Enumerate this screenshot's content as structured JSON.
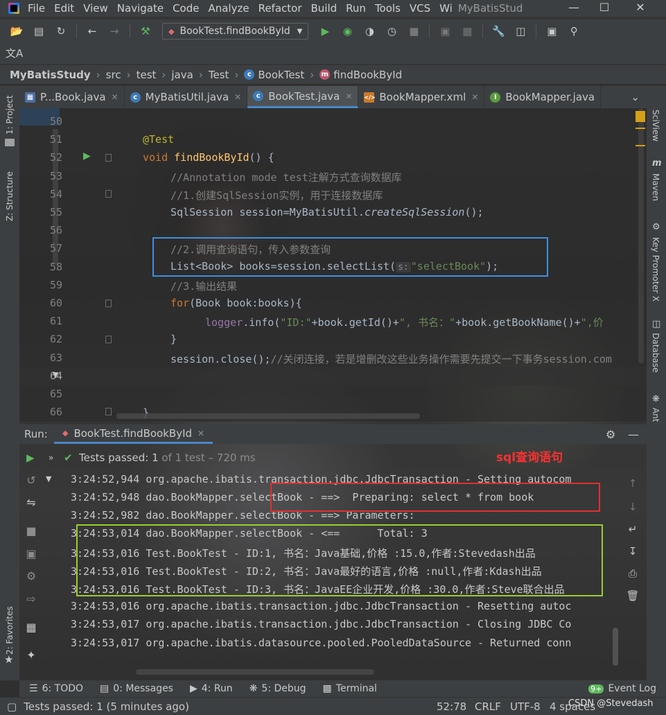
{
  "menu": [
    "File",
    "Edit",
    "View",
    "Navigate",
    "Code",
    "Analyze",
    "Refactor",
    "Build",
    "Run",
    "Tools",
    "VCS",
    "Wi"
  ],
  "window_title": "MyBatisStud",
  "toolbar": {
    "run_config": "BookTest.findBookById"
  },
  "translate_icon": "文A",
  "breadcrumbs": [
    "MyBatisStudy",
    "src",
    "test",
    "java",
    "Test",
    "BookTest",
    "findBookById"
  ],
  "tabs": [
    {
      "label": "P...Book.java",
      "icon_color": "#4a6fa5",
      "icon": "class-icon"
    },
    {
      "label": "MyBatisUtil.java",
      "icon_color": "#3d7ab8",
      "icon": "class-icon"
    },
    {
      "label": "BookTest.java",
      "icon_color": "#3d7ab8",
      "icon": "class-icon",
      "active": true
    },
    {
      "label": "BookMapper.xml",
      "icon_color": "#c87a2c",
      "icon": "xml-icon"
    },
    {
      "label": "BookMapper.java",
      "icon_color": "#5a9c3e",
      "icon": "interface-icon"
    }
  ],
  "left_tools": [
    "1: Project",
    "Z: Structure",
    "2: Favorites"
  ],
  "right_tools": [
    "SciView",
    "Maven",
    "Key Promoter X",
    "Database",
    "Ant"
  ],
  "editor": {
    "line_numbers": [
      "50",
      "51",
      "52",
      "53",
      "54",
      "55",
      "56",
      "57",
      "58",
      "59",
      "60",
      "61",
      "62",
      "63",
      "64",
      "65",
      "66"
    ],
    "lines": {
      "l51": "@Test",
      "l52_kw": "void",
      "l52_fn": "findBookById",
      "l52_rest": "() {",
      "l53": "//Annotation mode test注解方式查询数据库",
      "l54": "//1.创建SqlSession实例，用于连接数据库",
      "l55_a": "SqlSession session=MyBatisUtil.",
      "l55_b": "createSqlSession",
      "l55_c": "();",
      "l57": "//2.调用查询语句，传入参数查询",
      "l58_a": "List<Book> books=session.selectList(",
      "l58_hint": "s:",
      "l58_str": "\"selectBook\"",
      "l58_c": ");",
      "l59": "//3.输出结果",
      "l60_kw": "for",
      "l60_rest": "(Book book:books){",
      "l61_fld": "logger",
      "l61_a": ".info(",
      "l61_s1": "\"ID:\"",
      "l61_b": "+book.getId()+",
      "l61_s2": "\", 书名：\"",
      "l61_c": "+book.getBookName()+",
      "l61_s3": "\",价",
      "l62": "}",
      "l63_a": "session.close();",
      "l63_cm": "//关闭连接，若是增删改这些业务操作需要先提交一下事务session.com",
      "l66": "}"
    }
  },
  "run": {
    "label": "Run:",
    "tab": "BookTest.findBookById",
    "status_passed": "Tests passed:",
    "status_count": "1",
    "status_detail": "of 1 test – 720 ms",
    "annotation": "sql查询语句",
    "console": [
      "3:24:52,944 org.apache.ibatis.transaction.jdbc.JdbcTransaction - Setting autocom",
      "3:24:52,948 dao.BookMapper.selectBook - ==>  Preparing: select * from book",
      "3:24:52,982 dao.BookMapper.selectBook - ==> Parameters: ",
      "3:24:53,014 dao.BookMapper.selectBook - <==      Total: 3",
      "3:24:53,016 Test.BookTest - ID:1, 书名：Java基础,价格 :15.0,作者:Stevedash出品",
      "3:24:53,016 Test.BookTest - ID:2, 书名：Java最好的语言,价格 :null,作者:Kdash出品",
      "3:24:53,016 Test.BookTest - ID:3, 书名：JavaEE企业开发,价格 :30.0,作者:Steve联合出品",
      "3:24:53,016 org.apache.ibatis.transaction.jdbc.JdbcTransaction - Resetting autoc",
      "3:24:53,017 org.apache.ibatis.transaction.jdbc.JdbcTransaction - Closing JDBC Co",
      "3:24:53,017 org.apache.ibatis.datasource.pooled.PooledDataSource - Returned conn"
    ]
  },
  "tool_tabs": [
    {
      "label": "6: TODO",
      "icon": "list-icon"
    },
    {
      "label": "0: Messages",
      "icon": "messages-icon"
    },
    {
      "label": "4: Run",
      "icon": "run-icon"
    },
    {
      "label": "5: Debug",
      "icon": "debug-icon"
    },
    {
      "label": "Terminal",
      "icon": "terminal-icon"
    }
  ],
  "event_log": {
    "badge": "9+",
    "label": "Event Log"
  },
  "statusbar": {
    "message": "Tests passed: 1 (5 minutes ago)",
    "position": "52:78",
    "line_sep": "CRLF",
    "encoding": "UTF-8",
    "indent": "4 spaces",
    "watermark": "CSDN @Stevedash"
  },
  "colors": {
    "blue_box": "#3d8fe0",
    "red_box": "#e03030",
    "green_box": "#9acd32",
    "annotation": "#ff3030",
    "pass_green": "#5fb85f"
  }
}
